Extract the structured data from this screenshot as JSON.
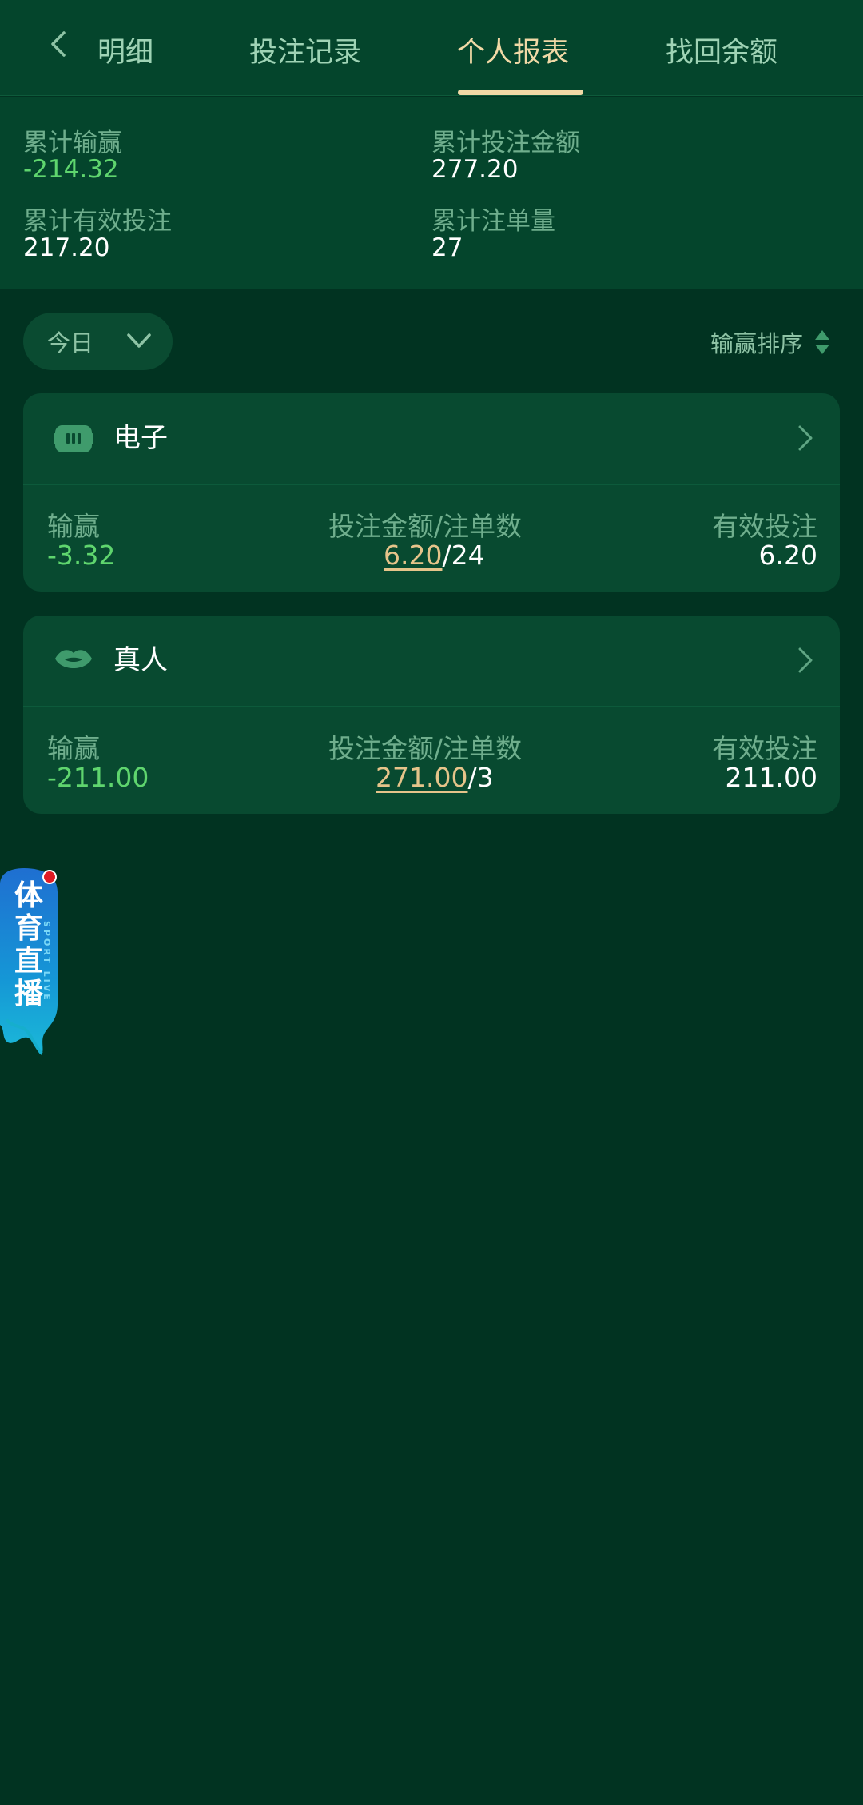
{
  "tabs": [
    {
      "label": "明细",
      "visible_label": "明细",
      "active": false
    },
    {
      "label": "投注记录",
      "active": false
    },
    {
      "label": "个人报表",
      "active": true
    },
    {
      "label": "找回余额",
      "active": false
    }
  ],
  "summary": {
    "total_winloss_label": "累计输赢",
    "total_winloss_value": "-214.32",
    "total_bet_amount_label": "累计投注金额",
    "total_bet_amount_value": "277.20",
    "total_valid_bet_label": "累计有效投注",
    "total_valid_bet_value": "217.20",
    "total_order_count_label": "累计注单量",
    "total_order_count_value": "27"
  },
  "filter": {
    "date_selected": "今日",
    "sort_label": "输赢排序"
  },
  "categories": [
    {
      "title": "电子",
      "icon": "electronic-game-icon",
      "winloss_label": "输赢",
      "winloss_value": "-3.32",
      "bet_label": "投注金额/注单数",
      "bet_amount": "6.20",
      "order_count": "/24",
      "valid_label": "有效投注",
      "valid_value": "6.20"
    },
    {
      "title": "真人",
      "icon": "live-casino-lips-icon",
      "winloss_label": "输赢",
      "winloss_value": "-211.00",
      "bet_label": "投注金额/注单数",
      "bet_amount": "271.00",
      "order_count": "/3",
      "valid_label": "有效投注",
      "valid_value": "211.00"
    }
  ],
  "live_badge": {
    "text": "体育直播",
    "subtext": "SPORT LIVE"
  },
  "colors": {
    "background": "#013321",
    "panel": "#04452c",
    "card": "#084a30",
    "active_tab": "#f1d9a6",
    "negative": "#5fd56e",
    "amount_link": "#e6c48a"
  }
}
